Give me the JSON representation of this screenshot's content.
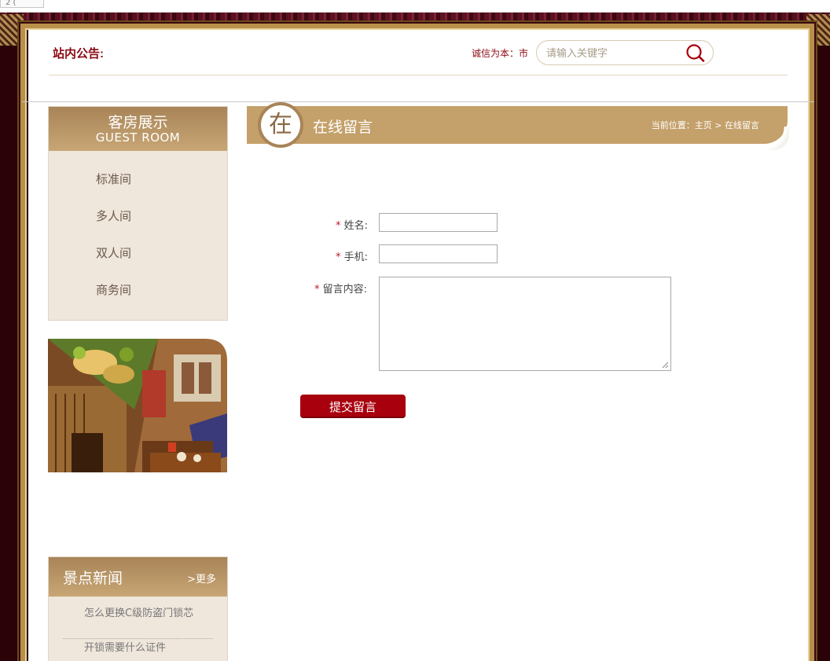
{
  "browser": {
    "tab_label": "2 ( ",
    "top_marks": "  "
  },
  "header": {
    "notice_label": "站内公告:",
    "slogan": "诚信为本：市",
    "search": {
      "placeholder": "请输入关键字",
      "icon": "search-icon"
    }
  },
  "sidebar": {
    "guest_room": {
      "title_cn": "客房展示",
      "title_en": "GUEST ROOM",
      "items": [
        "标准间",
        "多人间",
        "双人间",
        "商务间"
      ]
    },
    "news": {
      "title": "景点新闻",
      "more": ">更多",
      "items": [
        "怎么更换C级防盗门锁芯",
        "开锁需要什么证件"
      ]
    }
  },
  "page_title": {
    "badge_char": "在",
    "title": "在线留言",
    "breadcrumb_prefix": "当前位置：",
    "breadcrumb_home": "主页",
    "breadcrumb_sep": " > ",
    "breadcrumb_current": "在线留言"
  },
  "form": {
    "required_mark": "*",
    "name_label": "姓名:",
    "phone_label": "手机:",
    "message_label": "留言内容:",
    "name_value": "",
    "phone_value": "",
    "message_value": "",
    "submit_label": "提交留言"
  },
  "colors": {
    "brand_red": "#8b0a14",
    "gold": "#c4a06a",
    "sidebar_bg": "#efe6dc",
    "submit_bg": "#a8000d",
    "frame_maroon": "#3a0610"
  }
}
